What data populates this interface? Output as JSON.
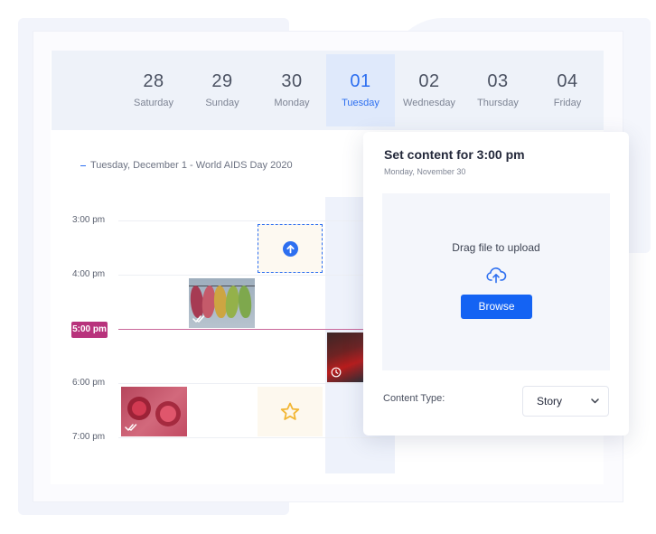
{
  "days": [
    {
      "num": "28",
      "name": "Saturday",
      "active": false
    },
    {
      "num": "29",
      "name": "Sunday",
      "active": false
    },
    {
      "num": "30",
      "name": "Monday",
      "active": false
    },
    {
      "num": "01",
      "name": "Tuesday",
      "active": true
    },
    {
      "num": "02",
      "name": "Wednesday",
      "active": false
    },
    {
      "num": "03",
      "name": "Thursday",
      "active": false
    },
    {
      "num": "04",
      "name": "Friday",
      "active": false
    }
  ],
  "event_text": "Tuesday, December 1 - World AIDS Day 2020",
  "time_slots": [
    "3:00 pm",
    "4:00 pm",
    "5:00 pm",
    "6:00 pm",
    "7:00 pm"
  ],
  "current_time": "5:00 pm",
  "panel": {
    "title": "Set content for 3:00 pm",
    "subtitle": "Monday, November 30",
    "drop_text": "Drag file to upload",
    "browse_label": "Browse",
    "content_type_label": "Content Type:",
    "content_type_value": "Story"
  },
  "icons": {
    "upload": "arrow-up-circle-icon",
    "cloud": "cloud-upload-icon",
    "star": "star-icon",
    "double_check": "double-check-icon",
    "clock": "clock-icon",
    "chevron": "chevron-down-icon"
  },
  "colors": {
    "accent": "#2d6ff0",
    "button": "#1463f3",
    "now_badge": "#b8337c",
    "star": "#f2b634"
  }
}
